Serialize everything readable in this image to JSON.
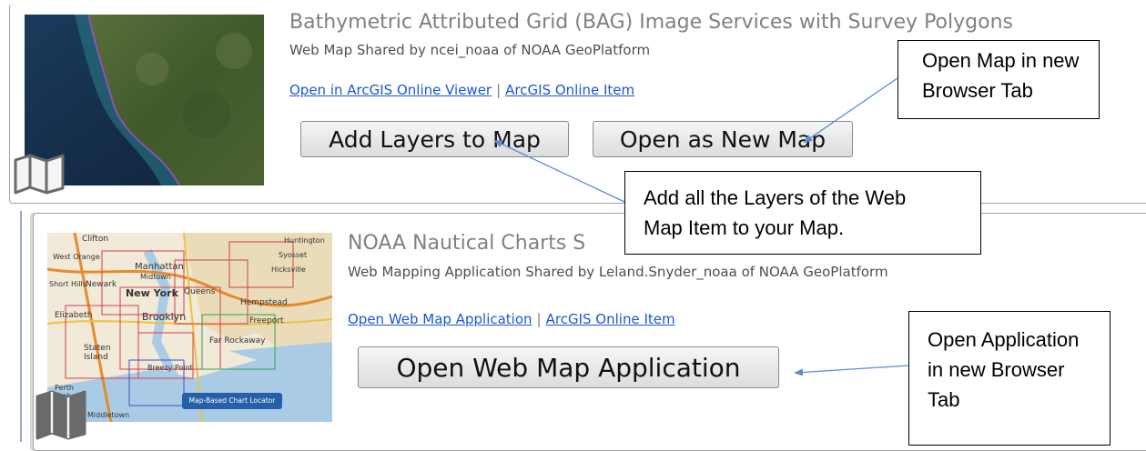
{
  "items": [
    {
      "title": "Bathymetric Attributed Grid (BAG) Image Services with Survey Polygons",
      "shared_by": "Web Map Shared by ncei_noaa of NOAA GeoPlatform",
      "link_primary": "Open in ArcGIS Online Viewer",
      "link_secondary": "ArcGIS Online Item",
      "link_separator": "|",
      "buttons": [
        "Add Layers to Map",
        "Open as New Map"
      ],
      "thumbnail_icon": "map-icon"
    },
    {
      "title": "NOAA Nautical Charts S",
      "shared_by": "Web Mapping Application Shared by Leland.Snyder_noaa of NOAA GeoPlatform",
      "link_primary": "Open Web Map Application",
      "link_secondary": "ArcGIS Online Item",
      "link_separator": "|",
      "buttons": [
        "Open Web Map Application"
      ],
      "thumbnail_icon": "map-icon",
      "thumbnail_labels": {
        "towns": [
          "Clifton",
          "West Orange",
          "Short Hills",
          "Newark",
          "Manhattan",
          "Midtown",
          "New York",
          "Queens",
          "Hicksville",
          "Hempstead",
          "Brooklyn",
          "Elizabeth",
          "Freeport",
          "Far Rockaway",
          "Staten Island",
          "Breezy Point",
          "Perth Amboy",
          "Middletown",
          "Syosset",
          "Huntington"
        ],
        "badge": "Map-Based Chart Locator"
      }
    }
  ],
  "callouts": [
    {
      "lines": [
        "Open Map in new",
        "Browser Tab"
      ]
    },
    {
      "lines": [
        "Add all the Layers of the Web",
        "Map Item to your Map."
      ]
    },
    {
      "lines": [
        "Open Application",
        "in new Browser",
        "Tab"
      ]
    }
  ],
  "colors": {
    "link": "#1a56d6",
    "arrow": "#5b8bd0",
    "title": "#808080",
    "callout_border": "#000000"
  }
}
